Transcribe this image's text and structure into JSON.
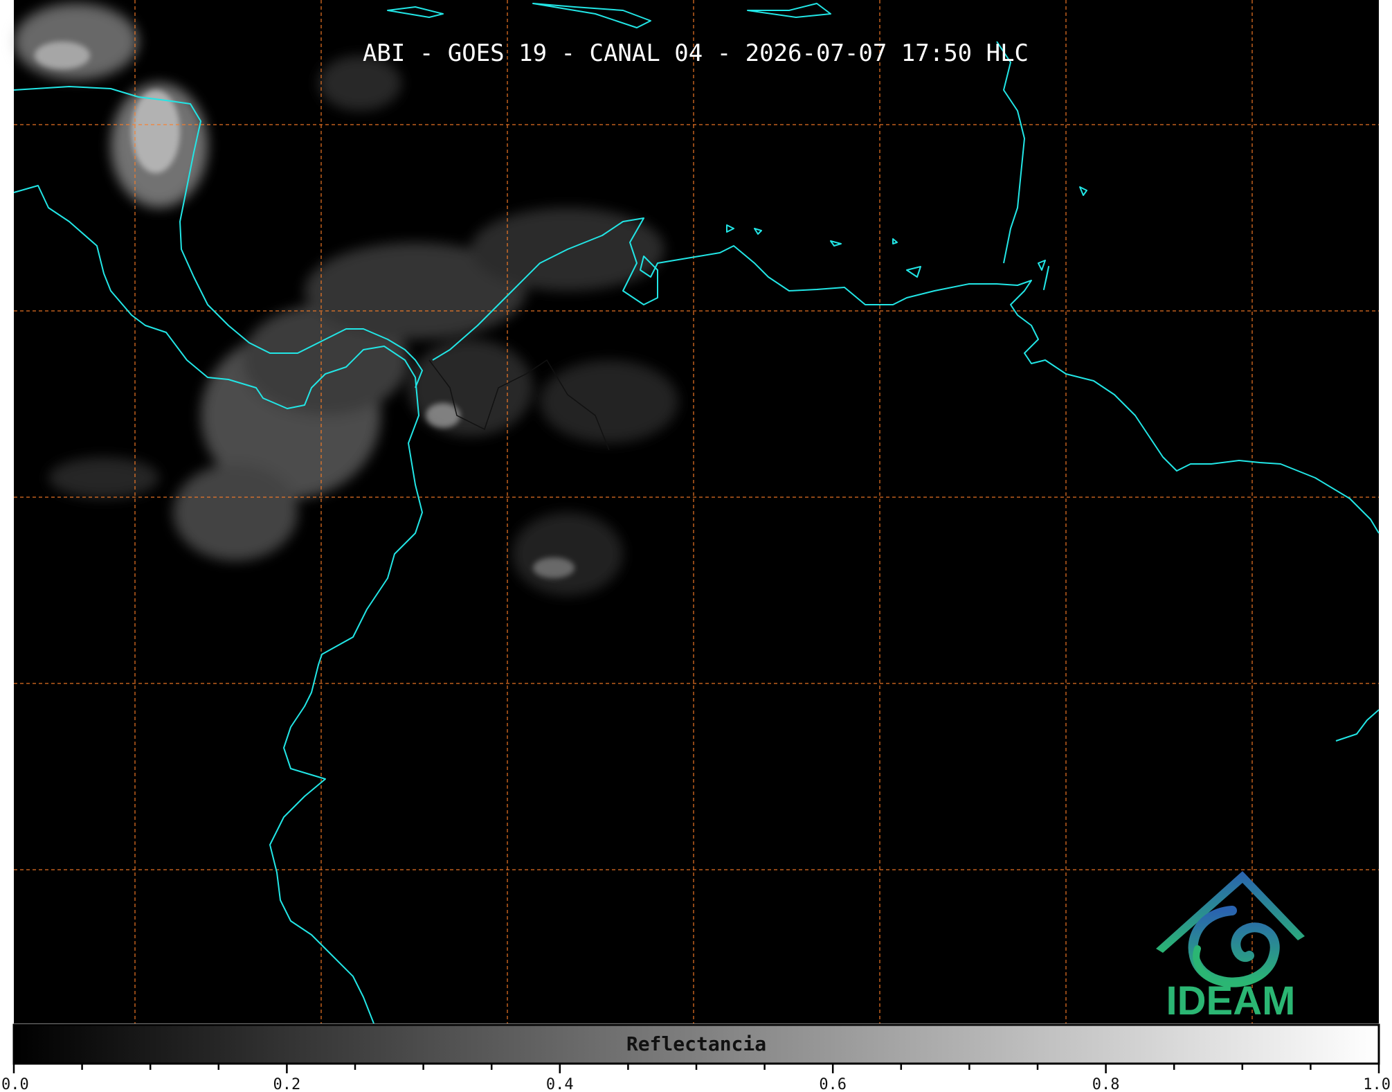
{
  "title": "ABI - GOES 19 - CANAL 04 - 2026-07-07 17:50 HLC",
  "colorbar": {
    "label": "Reflectancia",
    "ticks": [
      "0.0",
      "0.2",
      "0.4",
      "0.6",
      "0.8",
      "1.0"
    ],
    "min": 0,
    "max": 1,
    "colormap": "grayscale"
  },
  "logo": {
    "text": "IDEAM",
    "color": "#2bb673",
    "icon": "ideam-mountain-spiral-icon"
  },
  "map": {
    "background": "#000000",
    "coastline_color": "#22e6e6",
    "gridline_color": "#ff7f27",
    "gridline_style": "dashed",
    "cloud_color": "#ffffff"
  }
}
